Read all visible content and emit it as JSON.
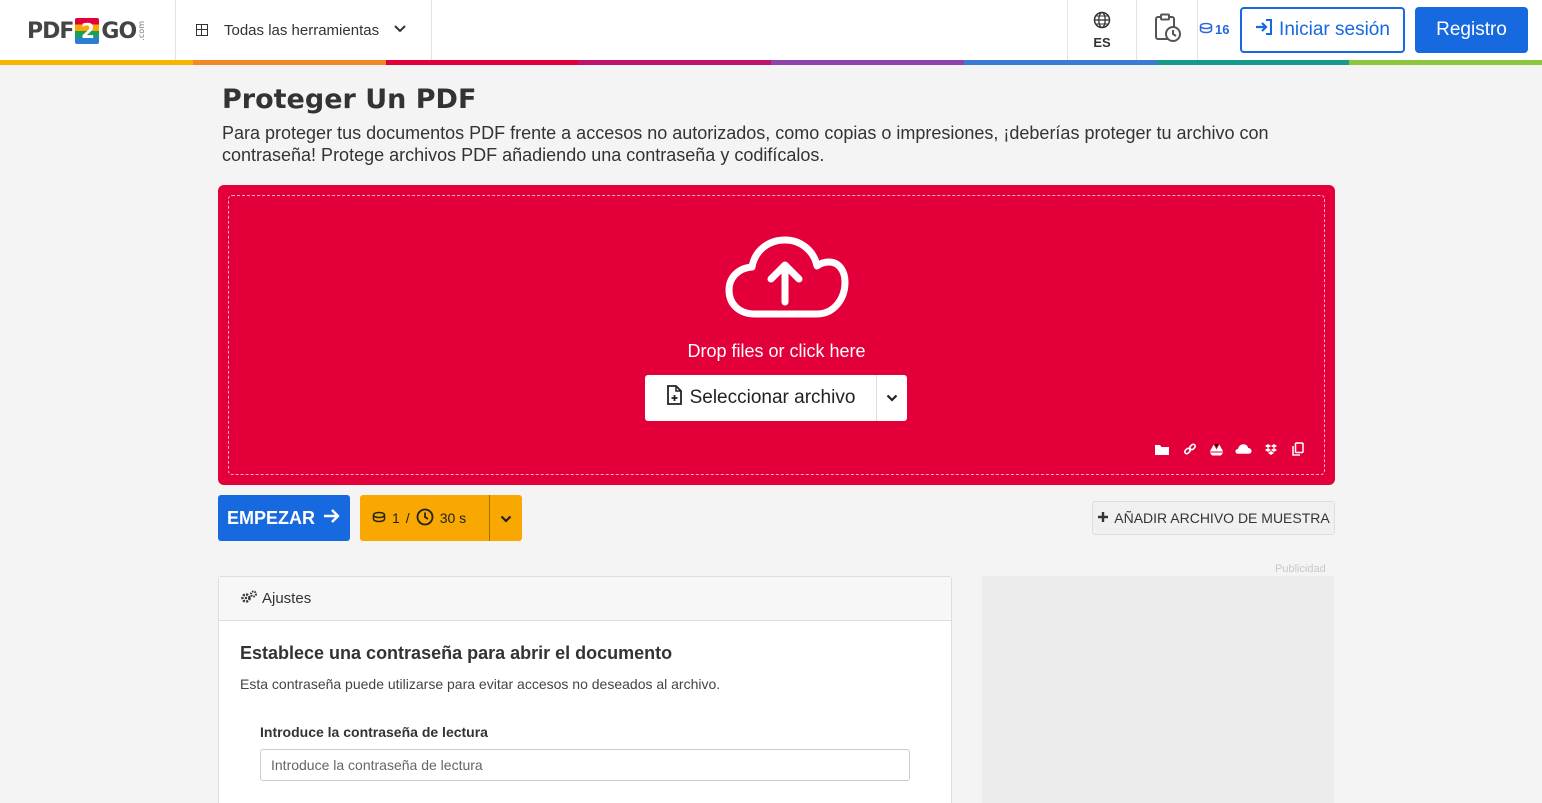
{
  "header": {
    "logo": {
      "left": "PDF",
      "mid": "2",
      "right": "GO",
      "suffix": ".com"
    },
    "tools_label": "Todas las herramientas",
    "language": "ES",
    "credits": "16",
    "login_label": "Iniciar sesión",
    "register_label": "Registro"
  },
  "rainbow": [
    "#f8b500",
    "#f08a24",
    "#e2003a",
    "#c0136b",
    "#8e44ad",
    "#3a7bd5",
    "#159a8c",
    "#8cc63f"
  ],
  "page": {
    "title": "Proteger Un PDF",
    "description": "Para proteger tus documentos PDF frente a accesos no autorizados, como copias o impresiones, ¡deberías proteger tu archivo con contraseña! Protege archivos PDF añadiendo una contraseña y codifícalos."
  },
  "dropzone": {
    "prompt": "Drop files or click here",
    "select_label": "Seleccionar archivo",
    "sources": [
      "folder-icon",
      "link-icon",
      "google-drive-icon",
      "onedrive-icon",
      "dropbox-icon",
      "clipboard-icon"
    ]
  },
  "actions": {
    "start_label": "EMPEZAR",
    "cost_credits": "1",
    "cost_separator": "/",
    "cost_time": "30 s",
    "sample_label": "AÑADIR ARCHIVO DE MUESTRA"
  },
  "settings": {
    "header": "Ajustes",
    "title": "Establece una contraseña para abrir el documento",
    "subtitle": "Esta contraseña puede utilizarse para evitar accesos no deseados al archivo.",
    "field_label": "Introduce la contraseña de lectura",
    "field_placeholder": "Introduce la contraseña de lectura",
    "field_value": ""
  },
  "ad": {
    "label": "Publicidad"
  },
  "colors": {
    "accent": "#1769e0",
    "dropzone": "#e3003a",
    "cost": "#f8a800"
  }
}
